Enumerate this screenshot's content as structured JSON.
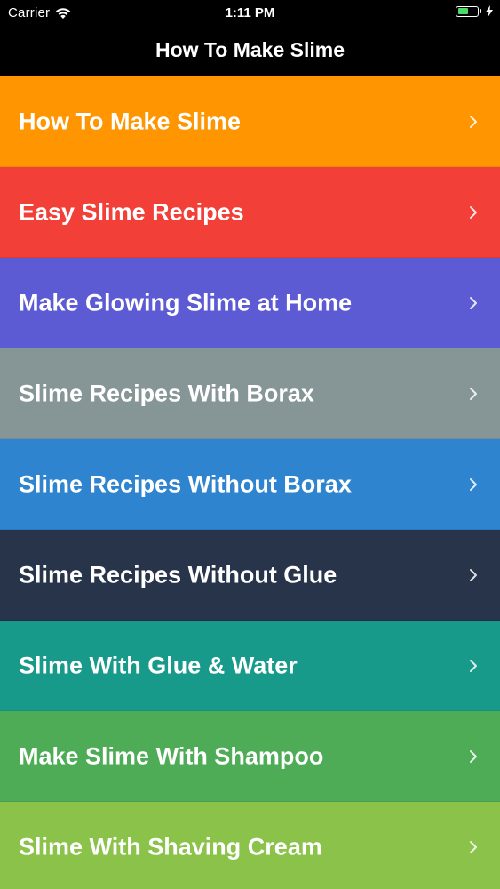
{
  "status_bar": {
    "carrier": "Carrier",
    "time": "1:11 PM",
    "battery_level": 0.55,
    "battery_color": "#4cd964"
  },
  "nav": {
    "title": "How To Make Slime"
  },
  "list": {
    "items": [
      {
        "label": "How To Make Slime",
        "color": "#ff9500",
        "icon": "chevron-right-icon"
      },
      {
        "label": "Easy Slime Recipes",
        "color": "#f24038",
        "icon": "chevron-right-icon"
      },
      {
        "label": "Make Glowing Slime at Home",
        "color": "#5d5bd4",
        "icon": "chevron-right-icon"
      },
      {
        "label": "Slime Recipes With Borax",
        "color": "#869596",
        "icon": "chevron-right-icon"
      },
      {
        "label": "Slime Recipes Without Borax",
        "color": "#2e84cf",
        "icon": "chevron-right-icon"
      },
      {
        "label": "Slime Recipes Without Glue",
        "color": "#27344a",
        "icon": "chevron-right-icon"
      },
      {
        "label": "Slime With Glue & Water",
        "color": "#189a8a",
        "icon": "chevron-right-icon"
      },
      {
        "label": "Make Slime With Shampoo",
        "color": "#4eac56",
        "icon": "chevron-right-icon"
      },
      {
        "label": "Slime With Shaving Cream",
        "color": "#8bc24a",
        "icon": "chevron-right-icon"
      }
    ]
  }
}
